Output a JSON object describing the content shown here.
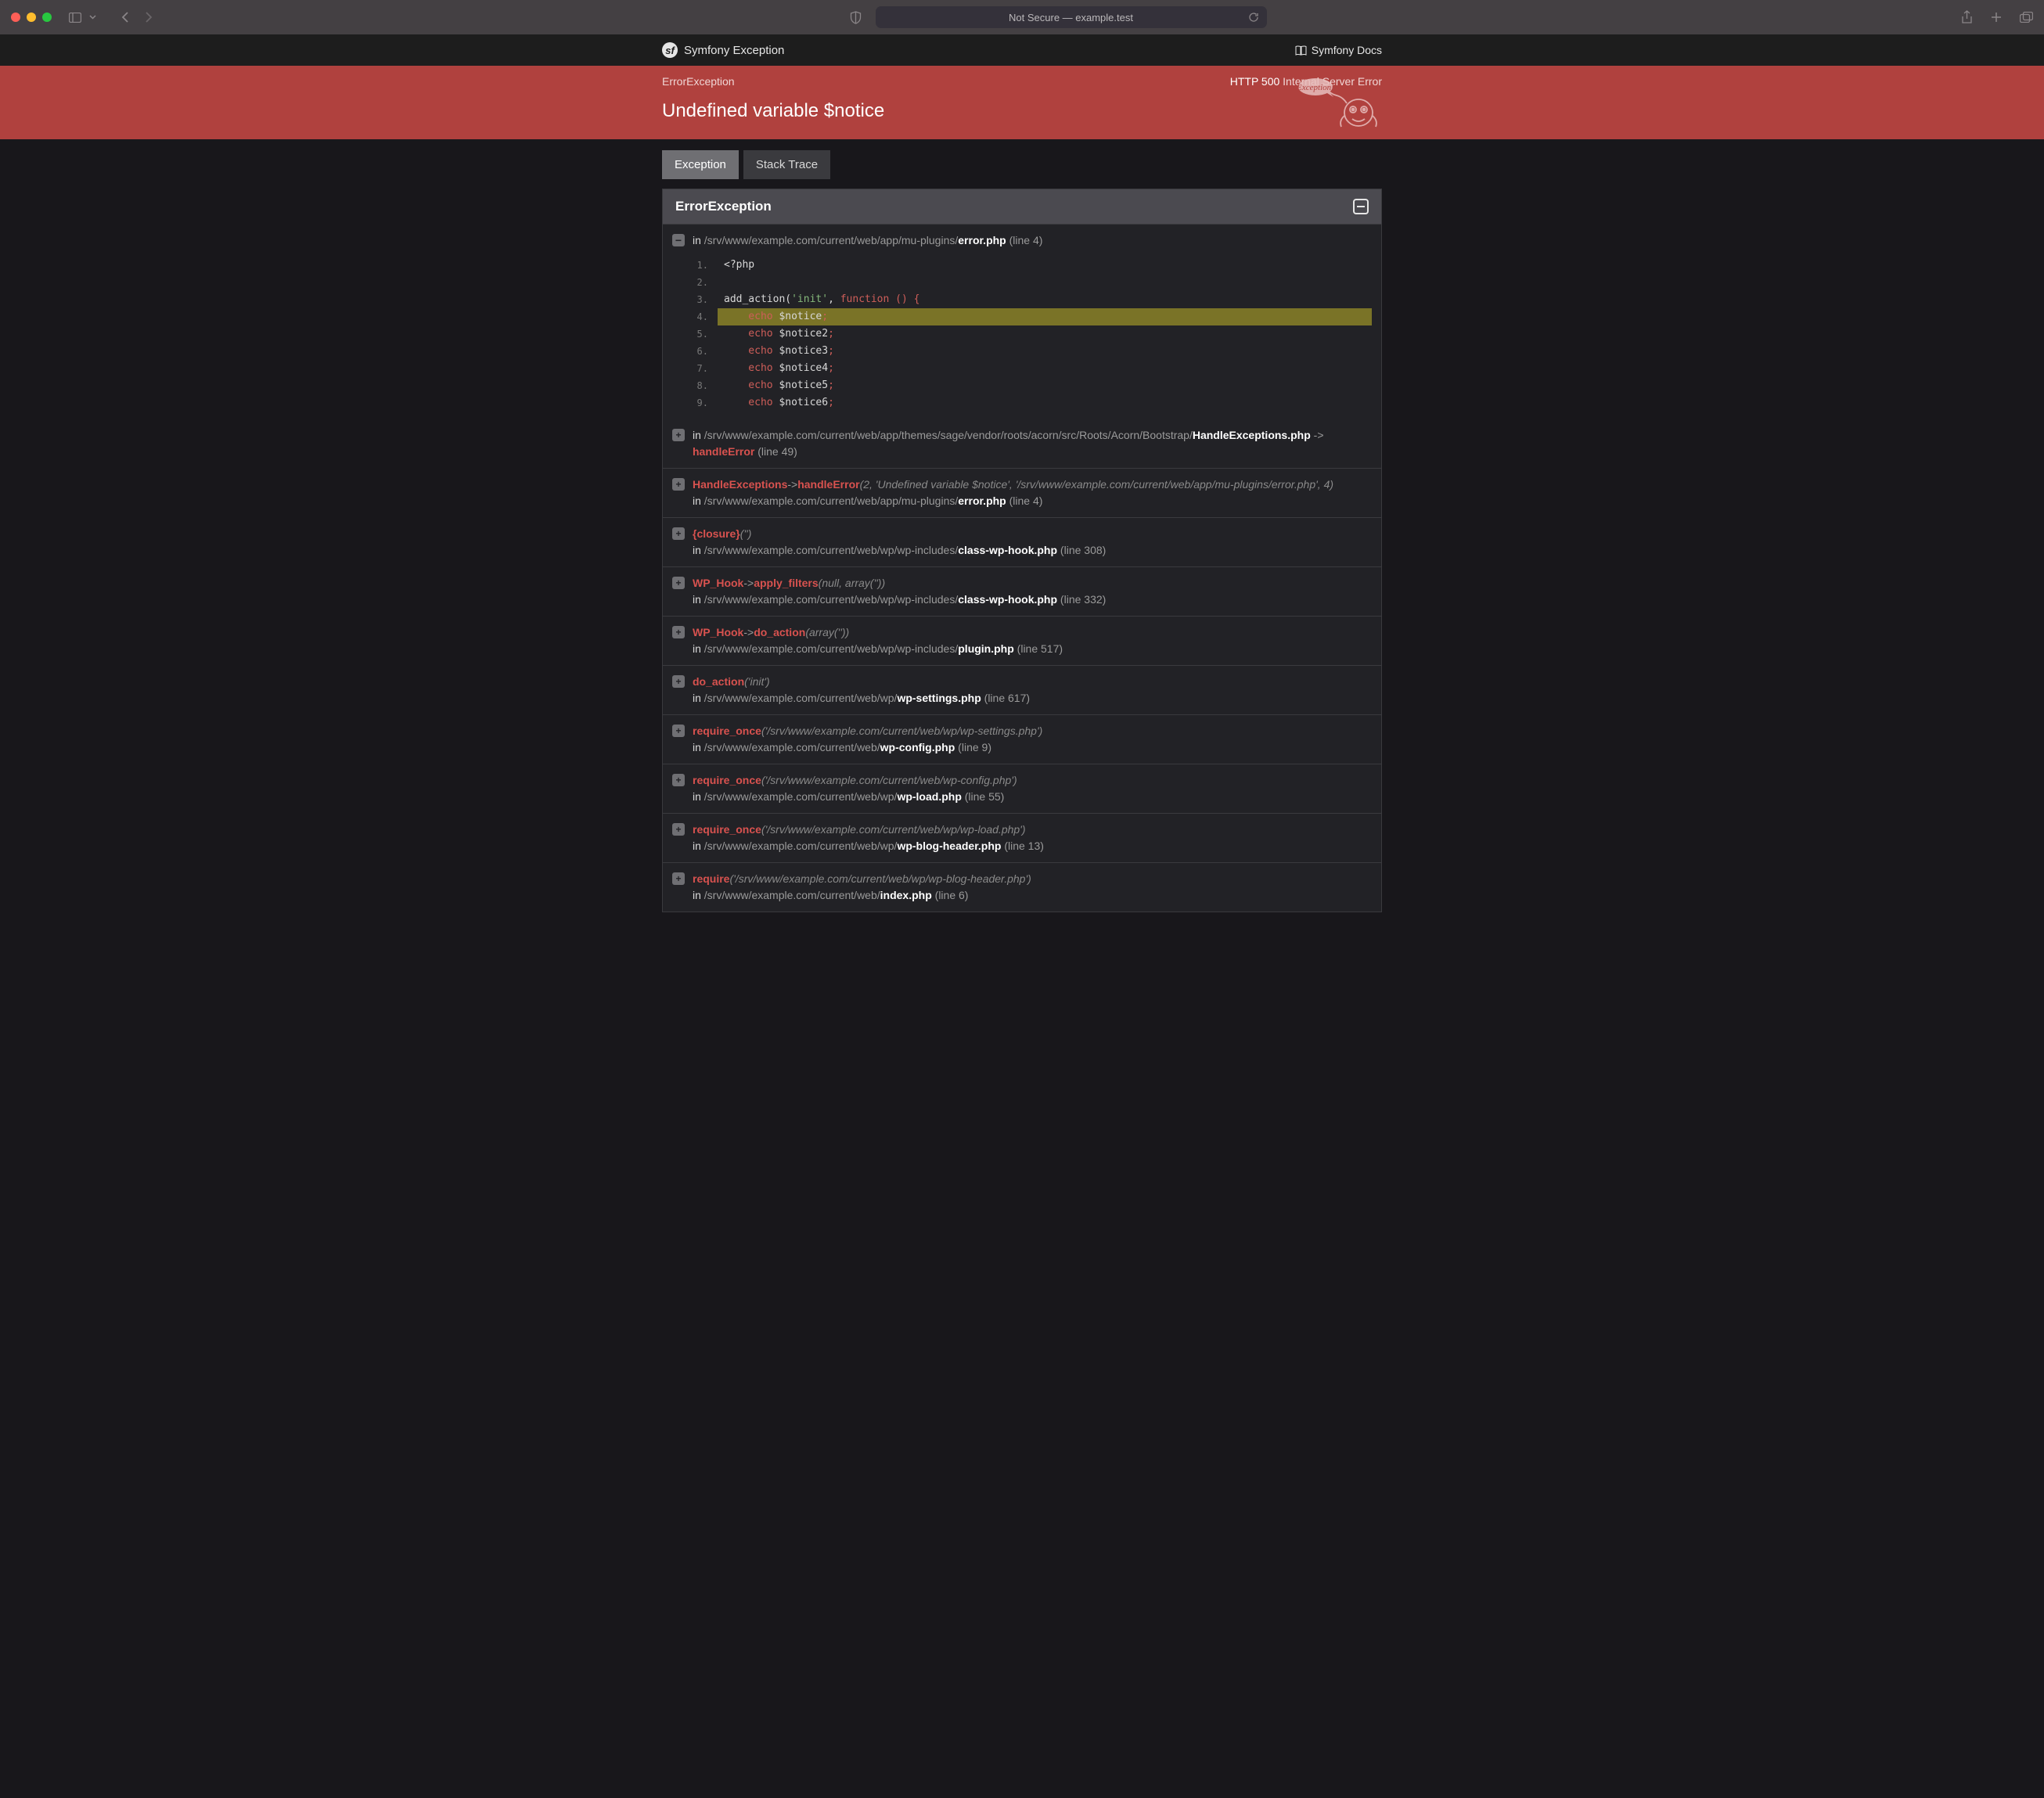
{
  "browser": {
    "address": "Not Secure — example.test"
  },
  "topbar": {
    "brand": "Symfony Exception",
    "docs": "Symfony Docs"
  },
  "banner": {
    "exception_class": "ErrorException",
    "http_code": "HTTP 500",
    "http_msg": "Internal Server Error",
    "title": "Undefined variable $notice",
    "bubble": "Exception!"
  },
  "tabs": {
    "exception": "Exception",
    "stack": "Stack Trace"
  },
  "panel": {
    "title": "ErrorException"
  },
  "frame0": {
    "in": "in ",
    "path": "/srv/www/example.com/current/web/app/mu-plugins/",
    "file": "error.php",
    "line": " (line 4)"
  },
  "code": {
    "l1": "<?php",
    "l2": "",
    "l3a": "add_action(",
    "l3b": "'init'",
    "l3c": ", ",
    "l3d": "function () {",
    "l4a": "    echo ",
    "l4b": "$notice",
    "l4c": ";",
    "l5a": "    echo ",
    "l5b": "$notice2",
    "l5c": ";",
    "l6a": "    echo ",
    "l6b": "$notice3",
    "l6c": ";",
    "l7a": "    echo ",
    "l7b": "$notice4",
    "l7c": ";",
    "l8a": "    echo ",
    "l8b": "$notice5",
    "l8c": ";",
    "l9a": "    echo ",
    "l9b": "$notice6",
    "l9c": ";",
    "n1": "1.",
    "n2": "2.",
    "n3": "3.",
    "n4": "4.",
    "n5": "5.",
    "n6": "6.",
    "n7": "7.",
    "n8": "8.",
    "n9": "9."
  },
  "frames": [
    {
      "top": {
        "in": "in ",
        "path": "/srv/www/example.com/current/web/app/themes/sage/vendor/roots/acorn/src/Roots/Acorn/Bootstrap/",
        "file": "HandleExceptions.php",
        "arrow": " -> ",
        "method": "handleError",
        "line": " (line 49)"
      }
    },
    {
      "top": {
        "cls": "HandleExceptions",
        "arrow": "->",
        "method": "handleError",
        "args": "(2, 'Undefined variable $notice', '/srv/www/example.com/current/web/app/mu-plugins/error.php', 4)"
      },
      "bot": {
        "in": "in ",
        "path": "/srv/www/example.com/current/web/app/mu-plugins/",
        "file": "error.php",
        "line": " (line 4)"
      }
    },
    {
      "top": {
        "cls": "{closure}",
        "args": "('')"
      },
      "bot": {
        "in": "in ",
        "path": "/srv/www/example.com/current/web/wp/wp-includes/",
        "file": "class-wp-hook.php",
        "line": " (line 308)"
      }
    },
    {
      "top": {
        "cls": "WP_Hook",
        "arrow": "->",
        "method": "apply_filters",
        "args": "(null, array(''))"
      },
      "bot": {
        "in": "in ",
        "path": "/srv/www/example.com/current/web/wp/wp-includes/",
        "file": "class-wp-hook.php",
        "line": " (line 332)"
      }
    },
    {
      "top": {
        "cls": "WP_Hook",
        "arrow": "->",
        "method": "do_action",
        "args": "(array(''))"
      },
      "bot": {
        "in": "in ",
        "path": "/srv/www/example.com/current/web/wp/wp-includes/",
        "file": "plugin.php",
        "line": " (line 517)"
      }
    },
    {
      "top": {
        "cls": "do_action",
        "args": "('init')"
      },
      "bot": {
        "in": "in ",
        "path": "/srv/www/example.com/current/web/wp/",
        "file": "wp-settings.php",
        "line": " (line 617)"
      }
    },
    {
      "top": {
        "cls": "require_once",
        "args": "('/srv/www/example.com/current/web/wp/wp-settings.php')"
      },
      "bot": {
        "in": "in ",
        "path": "/srv/www/example.com/current/web/",
        "file": "wp-config.php",
        "line": " (line 9)"
      }
    },
    {
      "top": {
        "cls": "require_once",
        "args": "('/srv/www/example.com/current/web/wp-config.php')"
      },
      "bot": {
        "in": "in ",
        "path": "/srv/www/example.com/current/web/wp/",
        "file": "wp-load.php",
        "line": " (line 55)"
      }
    },
    {
      "top": {
        "cls": "require_once",
        "args": "('/srv/www/example.com/current/web/wp/wp-load.php')"
      },
      "bot": {
        "in": "in ",
        "path": "/srv/www/example.com/current/web/wp/",
        "file": "wp-blog-header.php",
        "line": " (line 13)"
      }
    },
    {
      "top": {
        "cls": "require",
        "args": "('/srv/www/example.com/current/web/wp/wp-blog-header.php')"
      },
      "bot": {
        "in": "in ",
        "path": "/srv/www/example.com/current/web/",
        "file": "index.php",
        "line": " (line 6)"
      }
    }
  ]
}
